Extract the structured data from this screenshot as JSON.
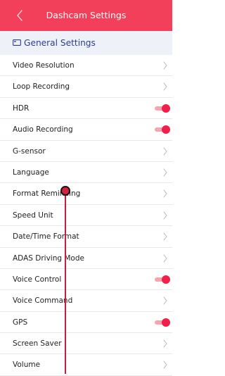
{
  "header": {
    "back_icon": "chevron-left-icon",
    "title": "Dashcam Settings",
    "color": "#f3405a"
  },
  "section": {
    "icon": "camera-outline-icon",
    "title": "General Settings",
    "color": "#2b3f8e"
  },
  "accent": "#f02048",
  "items": [
    {
      "label": "Video Resolution",
      "control": "chevron"
    },
    {
      "label": "Loop Recording",
      "control": "chevron"
    },
    {
      "label": "HDR",
      "control": "toggle",
      "on": true
    },
    {
      "label": "Audio Recording",
      "control": "toggle",
      "on": true
    },
    {
      "label": "G-sensor",
      "control": "chevron"
    },
    {
      "label": "Language",
      "control": "chevron"
    },
    {
      "label": "Format Reminding",
      "control": "chevron"
    },
    {
      "label": "Speed Unit",
      "control": "chevron"
    },
    {
      "label": "Date/Time Format",
      "control": "chevron"
    },
    {
      "label": "ADAS Driving Mode",
      "control": "chevron"
    },
    {
      "label": "Voice Control",
      "control": "toggle",
      "on": true
    },
    {
      "label": "Voice Command",
      "control": "chevron"
    },
    {
      "label": "GPS",
      "control": "toggle",
      "on": true
    },
    {
      "label": "Screen Saver",
      "control": "chevron"
    },
    {
      "label": "Volume",
      "control": "chevron"
    }
  ]
}
